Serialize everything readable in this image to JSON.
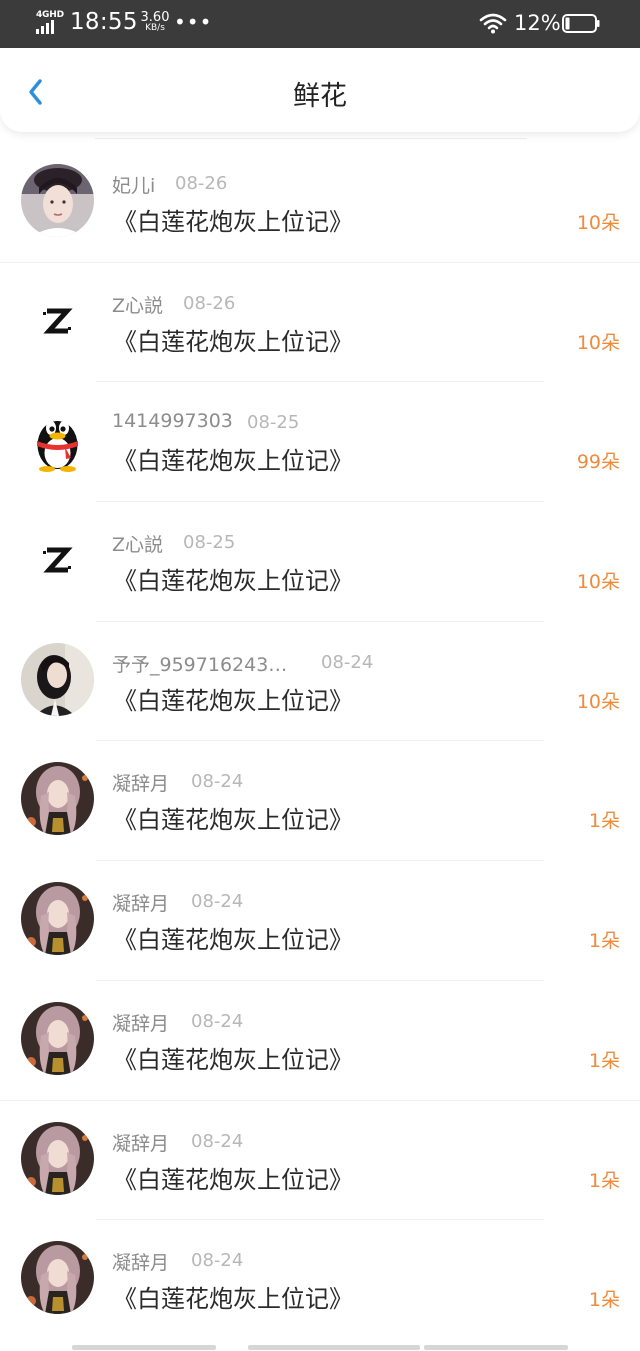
{
  "status_bar": {
    "network": "4GHD",
    "time": "18:55",
    "speed_value": "3.60",
    "speed_unit": "KB/s",
    "more": "•••",
    "battery_pct": "12%"
  },
  "header": {
    "title": "鲜花",
    "back_icon": "chevron-left-icon"
  },
  "colors": {
    "accent_back": "#2a8fdc",
    "flower_count": "#f08a3c",
    "status_bar_bg": "#3b3b3b"
  },
  "items": [
    {
      "name": "妃儿i",
      "date": "08-26",
      "book": "《白莲花炮灰上位记》",
      "count": "10朵",
      "avatar": "portrait-avatar"
    },
    {
      "name": "Z心説",
      "date": "08-26",
      "book": "《白莲花炮灰上位记》",
      "count": "10朵",
      "avatar": "z-logo-avatar"
    },
    {
      "name": "1414997303",
      "date": "08-25",
      "book": "《白莲花炮灰上位记》",
      "count": "99朵",
      "avatar": "qq-penguin-avatar"
    },
    {
      "name": "Z心説",
      "date": "08-25",
      "book": "《白莲花炮灰上位记》",
      "count": "10朵",
      "avatar": "z-logo-avatar"
    },
    {
      "name": "予予_959716243…",
      "date": "08-24",
      "book": "《白莲花炮灰上位记》",
      "count": "10朵",
      "avatar": "girl-avatar"
    },
    {
      "name": "凝辞月",
      "date": "08-24",
      "book": "《白莲花炮灰上位记》",
      "count": "1朵",
      "avatar": "anime-avatar"
    },
    {
      "name": "凝辞月",
      "date": "08-24",
      "book": "《白莲花炮灰上位记》",
      "count": "1朵",
      "avatar": "anime-avatar"
    },
    {
      "name": "凝辞月",
      "date": "08-24",
      "book": "《白莲花炮灰上位记》",
      "count": "1朵",
      "avatar": "anime-avatar"
    },
    {
      "name": "凝辞月",
      "date": "08-24",
      "book": "《白莲花炮灰上位记》",
      "count": "1朵",
      "avatar": "anime-avatar"
    },
    {
      "name": "凝辞月",
      "date": "08-24",
      "book": "《白莲花炮灰上位记》",
      "count": "1朵",
      "avatar": "anime-avatar"
    }
  ]
}
